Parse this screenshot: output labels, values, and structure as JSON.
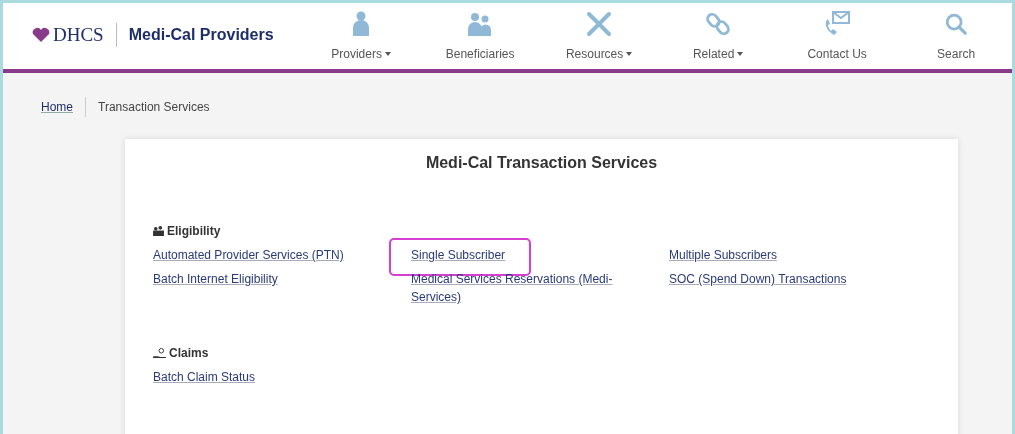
{
  "header": {
    "logo_text": "DHCS",
    "site_title": "Medi-Cal Providers"
  },
  "nav": [
    {
      "label": "Providers",
      "dropdown": true
    },
    {
      "label": "Beneficiaries",
      "dropdown": false
    },
    {
      "label": "Resources",
      "dropdown": true
    },
    {
      "label": "Related",
      "dropdown": true
    },
    {
      "label": "Contact Us",
      "dropdown": false
    },
    {
      "label": "Search",
      "dropdown": false
    }
  ],
  "breadcrumb": [
    {
      "label": "Home",
      "link": true
    },
    {
      "label": "Transaction Services",
      "link": false
    }
  ],
  "card": {
    "title": "Medi-Cal Transaction Services",
    "sections": [
      {
        "title": "Eligibility",
        "links": [
          {
            "label": "Automated Provider Services (PTN)",
            "highlighted": false
          },
          {
            "label": "Single Subscriber",
            "highlighted": true
          },
          {
            "label": "Multiple Subscribers",
            "highlighted": false
          },
          {
            "label": "Batch Internet Eligibility",
            "highlighted": false
          },
          {
            "label": "Medical Services Reservations (Medi-Services)",
            "highlighted": false
          },
          {
            "label": "SOC (Spend Down) Transactions",
            "highlighted": false
          }
        ]
      },
      {
        "title": "Claims",
        "links": [
          {
            "label": "Batch Claim Status",
            "highlighted": false
          }
        ]
      }
    ]
  }
}
